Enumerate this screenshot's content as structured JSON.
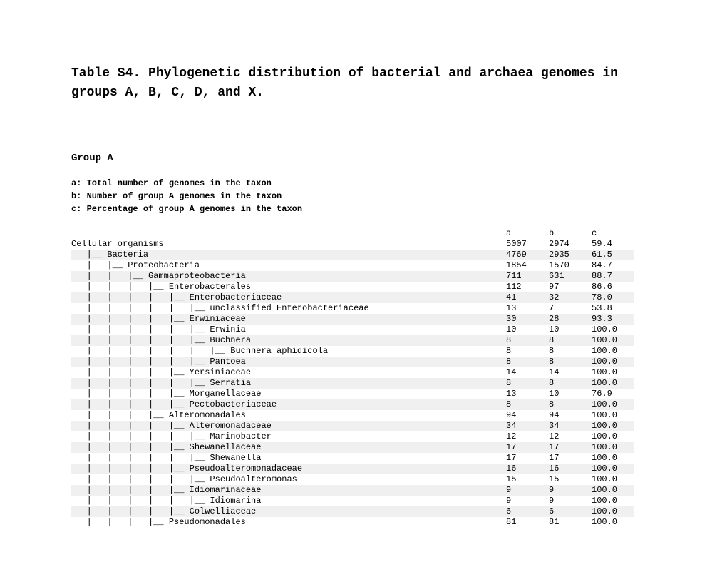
{
  "title": "Table S4. Phylogenetic distribution of bacterial and archaea genomes in groups A, B, C, D, and X.",
  "group_heading": "Group A",
  "legend_a": "a: Total number of genomes in the taxon",
  "legend_b": "b: Number of group A genomes in the taxon",
  "legend_c": "c: Percentage of group A genomes in the taxon",
  "col_a": "a",
  "col_b": "b",
  "col_c": "c",
  "rows": [
    {
      "label": "Cellular organisms",
      "a": "5007",
      "b": "2974",
      "c": "59.4",
      "alt": false
    },
    {
      "label": "   |__ Bacteria",
      "a": "4769",
      "b": "2935",
      "c": "61.5",
      "alt": true
    },
    {
      "label": "   |   |__ Proteobacteria",
      "a": "1854",
      "b": "1570",
      "c": "84.7",
      "alt": false
    },
    {
      "label": "   |   |   |__ Gammaproteobacteria",
      "a": "711",
      "b": "631",
      "c": "88.7",
      "alt": true
    },
    {
      "label": "   |   |   |   |__ Enterobacterales",
      "a": "112",
      "b": "97",
      "c": "86.6",
      "alt": false
    },
    {
      "label": "   |   |   |   |   |__ Enterobacteriaceae",
      "a": "41",
      "b": "32",
      "c": "78.0",
      "alt": true
    },
    {
      "label": "   |   |   |   |   |   |__ unclassified Enterobacteriaceae",
      "a": "13",
      "b": "7",
      "c": "53.8",
      "alt": false
    },
    {
      "label": "   |   |   |   |   |__ Erwiniaceae",
      "a": "30",
      "b": "28",
      "c": "93.3",
      "alt": true
    },
    {
      "label": "   |   |   |   |   |   |__ Erwinia",
      "a": "10",
      "b": "10",
      "c": "100.0",
      "alt": false
    },
    {
      "label": "   |   |   |   |   |   |__ Buchnera",
      "a": "8",
      "b": "8",
      "c": "100.0",
      "alt": true
    },
    {
      "label": "   |   |   |   |   |   |   |__ Buchnera aphidicola",
      "a": "8",
      "b": "8",
      "c": "100.0",
      "alt": false
    },
    {
      "label": "   |   |   |   |   |   |__ Pantoea",
      "a": "8",
      "b": "8",
      "c": "100.0",
      "alt": true
    },
    {
      "label": "   |   |   |   |   |__ Yersiniaceae",
      "a": "14",
      "b": "14",
      "c": "100.0",
      "alt": false
    },
    {
      "label": "   |   |   |   |   |   |__ Serratia",
      "a": "8",
      "b": "8",
      "c": "100.0",
      "alt": true
    },
    {
      "label": "   |   |   |   |   |__ Morganellaceae",
      "a": "13",
      "b": "10",
      "c": "76.9",
      "alt": false
    },
    {
      "label": "   |   |   |   |   |__ Pectobacteriaceae",
      "a": "8",
      "b": "8",
      "c": "100.0",
      "alt": true
    },
    {
      "label": "   |   |   |   |__ Alteromonadales",
      "a": "94",
      "b": "94",
      "c": "100.0",
      "alt": false
    },
    {
      "label": "   |   |   |   |   |__ Alteromonadaceae",
      "a": "34",
      "b": "34",
      "c": "100.0",
      "alt": true
    },
    {
      "label": "   |   |   |   |   |   |__ Marinobacter",
      "a": "12",
      "b": "12",
      "c": "100.0",
      "alt": false
    },
    {
      "label": "   |   |   |   |   |__ Shewanellaceae",
      "a": "17",
      "b": "17",
      "c": "100.0",
      "alt": true
    },
    {
      "label": "   |   |   |   |   |   |__ Shewanella",
      "a": "17",
      "b": "17",
      "c": "100.0",
      "alt": false
    },
    {
      "label": "   |   |   |   |   |__ Pseudoalteromonadaceae",
      "a": "16",
      "b": "16",
      "c": "100.0",
      "alt": true
    },
    {
      "label": "   |   |   |   |   |   |__ Pseudoalteromonas",
      "a": "15",
      "b": "15",
      "c": "100.0",
      "alt": false
    },
    {
      "label": "   |   |   |   |   |__ Idiomarinaceae",
      "a": "9",
      "b": "9",
      "c": "100.0",
      "alt": true
    },
    {
      "label": "   |   |   |   |   |   |__ Idiomarina",
      "a": "9",
      "b": "9",
      "c": "100.0",
      "alt": false
    },
    {
      "label": "   |   |   |   |   |__ Colwelliaceae",
      "a": "6",
      "b": "6",
      "c": "100.0",
      "alt": true
    },
    {
      "label": "   |   |   |   |__ Pseudomonadales",
      "a": "81",
      "b": "81",
      "c": "100.0",
      "alt": false
    }
  ]
}
